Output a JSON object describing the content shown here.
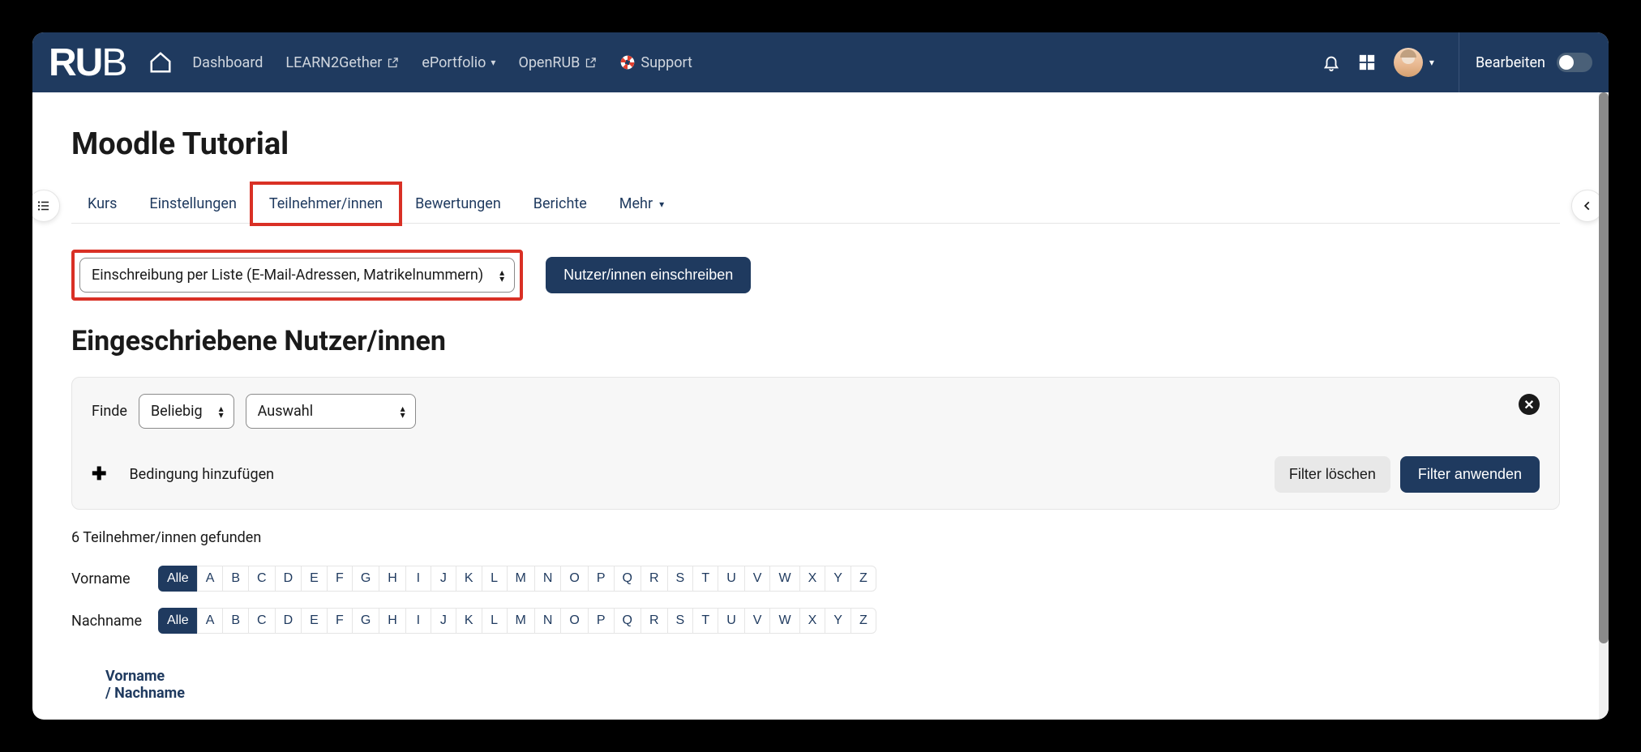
{
  "brand": {
    "bold": "RU",
    "thin": "B"
  },
  "nav": {
    "dashboard": "Dashboard",
    "learn2gether": "LEARN2Gether",
    "eportfolio": "ePortfolio",
    "openrub": "OpenRUB",
    "support": "Support"
  },
  "edit_mode_label": "Bearbeiten",
  "page_title": "Moodle Tutorial",
  "tabs": {
    "kurs": "Kurs",
    "einstellungen": "Einstellungen",
    "teilnehmer": "Teilnehmer/innen",
    "bewertungen": "Bewertungen",
    "berichte": "Berichte",
    "mehr": "Mehr"
  },
  "enroll_method_select": "Einschreibung per Liste (E-Mail-Adressen, Matrikelnummern)",
  "enroll_button": "Nutzer/innen einschreiben",
  "section_title": "Eingeschriebene Nutzer/innen",
  "filter": {
    "find_label": "Finde",
    "match_select": "Beliebig",
    "type_select": "Auswahl",
    "add_condition": "Bedingung hinzufügen",
    "clear_button": "Filter löschen",
    "apply_button": "Filter anwenden"
  },
  "result_count": "6 Teilnehmer/innen gefunden",
  "firstname_label": "Vorname",
  "lastname_label": "Nachname",
  "all_label": "Alle",
  "letters": [
    "A",
    "B",
    "C",
    "D",
    "E",
    "F",
    "G",
    "H",
    "I",
    "J",
    "K",
    "L",
    "M",
    "N",
    "O",
    "P",
    "Q",
    "R",
    "S",
    "T",
    "U",
    "V",
    "W",
    "X",
    "Y",
    "Z"
  ],
  "table_header_firstname": "Vorname",
  "table_header_lastname": "/ Nachname"
}
